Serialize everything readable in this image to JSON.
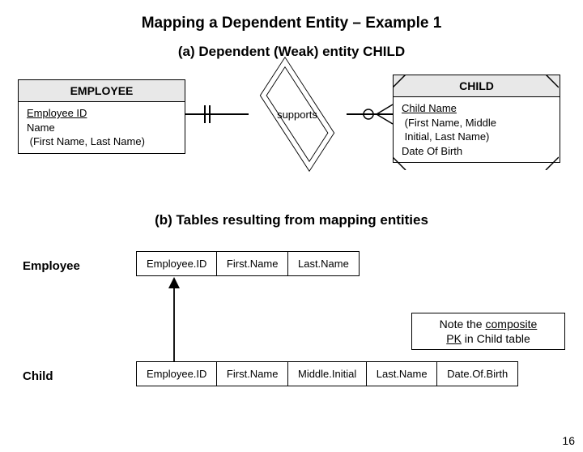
{
  "title": "Mapping a Dependent Entity – Example 1",
  "subtitle_a": "(a) Dependent (Weak) entity CHILD",
  "employee": {
    "header": "EMPLOYEE",
    "a1": "Employee ID",
    "a2": "Name",
    "a3": " (First Name, Last Name)"
  },
  "child": {
    "header": "CHILD",
    "a1": "Child Name",
    "a2": " (First Name, Middle",
    "a3": " Initial, Last Name)",
    "a4": "Date Of Birth"
  },
  "relationship": "supports",
  "subtitle_b": "(b) Tables resulting from mapping entities",
  "tables": {
    "emp_label": "Employee",
    "child_label": "Child",
    "emp_cols": {
      "c0": "Employee.ID",
      "c1": "First.Name",
      "c2": "Last.Name"
    },
    "child_cols": {
      "c0": "Employee.ID",
      "c1": "First.Name",
      "c2": "Middle.Initial",
      "c3": "Last.Name",
      "c4": "Date.Of.Birth"
    }
  },
  "note": {
    "l1": "Note the ",
    "l2": "composite",
    "l3": "PK",
    "l4": " in Child table"
  },
  "page": "16"
}
